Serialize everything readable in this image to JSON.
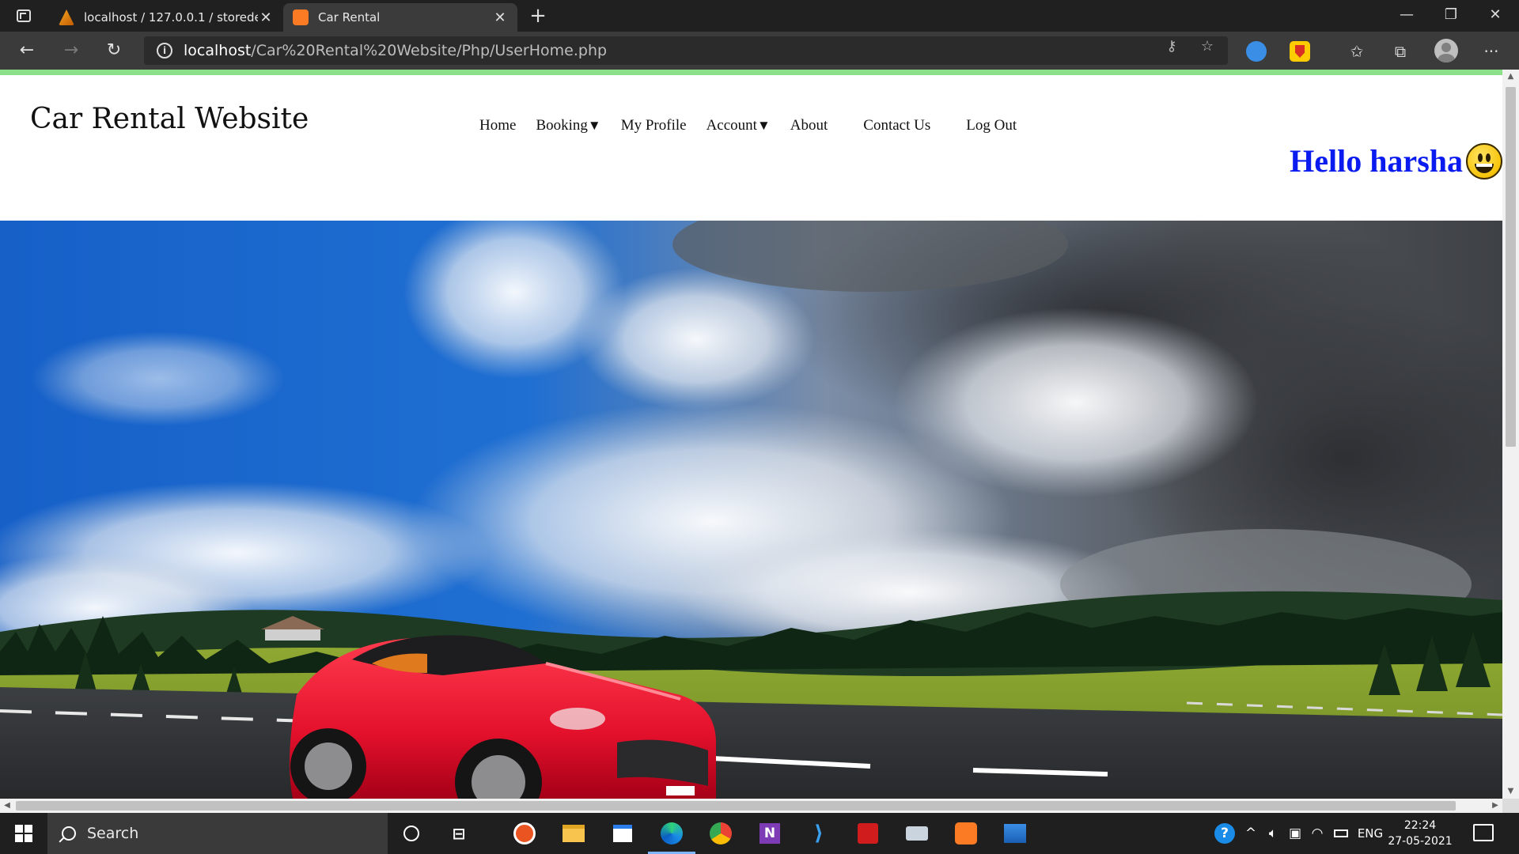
{
  "browser": {
    "tabs": [
      {
        "title": "localhost / 127.0.0.1 / storedetail",
        "icon": "phpmyadmin-sail-icon",
        "active": false
      },
      {
        "title": "Car Rental",
        "icon": "xampp-icon",
        "active": true
      }
    ],
    "url_host": "localhost",
    "url_path": "/Car%20Rental%20Website/Php/UserHome.php"
  },
  "page": {
    "site_title": "Car Rental Website",
    "nav": [
      {
        "label": "Home",
        "dropdown": false
      },
      {
        "label": "Booking",
        "dropdown": true
      },
      {
        "label": "My Profile",
        "dropdown": false
      },
      {
        "label": "Account",
        "dropdown": true
      },
      {
        "label": "About",
        "dropdown": false
      },
      {
        "label": "Contact Us",
        "dropdown": false
      },
      {
        "label": "Log Out",
        "dropdown": false
      }
    ],
    "dropdown_arrow": "▼",
    "greeting": "Hello harsha",
    "greeting_emoji": "grinning-face-icon",
    "greeting_color": "#0a1bf0",
    "accent_color": "#8de08a"
  },
  "taskbar": {
    "search_placeholder": "Search",
    "language": "ENG",
    "time": "22:24",
    "date": "27-05-2021"
  }
}
